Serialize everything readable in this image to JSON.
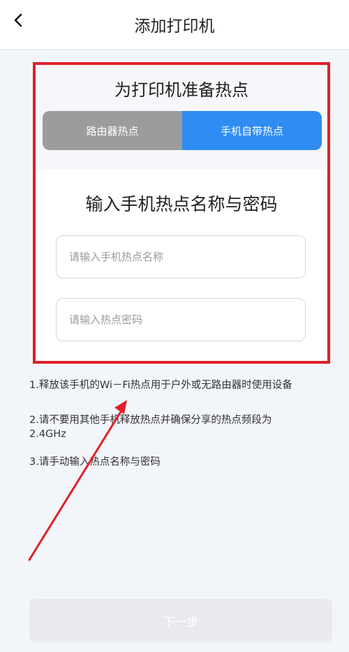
{
  "header": {
    "title": "添加打印机",
    "back_icon": "chevron-left-icon"
  },
  "hotspot_setup": {
    "title": "为打印机准备热点",
    "tabs": [
      {
        "label": "路由器热点",
        "selected": false
      },
      {
        "label": "手机自带热点",
        "selected": true
      }
    ],
    "form": {
      "title": "输入手机热点名称与密码",
      "name_placeholder": "请输入手机热点名称",
      "name_value": "",
      "password_placeholder": "请输入热点密码",
      "password_value": ""
    }
  },
  "tips": [
    "1.释放该手机的Wi－Fi热点用于户外或无路由器时使用设备",
    "2.请不要用其他手机释放热点并确保分享的热点频段为\n2.4GHz",
    "3.请手动输入热点名称与密码"
  ],
  "footer": {
    "next_label": "下一步"
  },
  "colors": {
    "accent": "#2f8cf3",
    "inactive_tab": "#9c9c9c",
    "highlight": "#e0202a",
    "disabled_button": "#e9eaed"
  }
}
